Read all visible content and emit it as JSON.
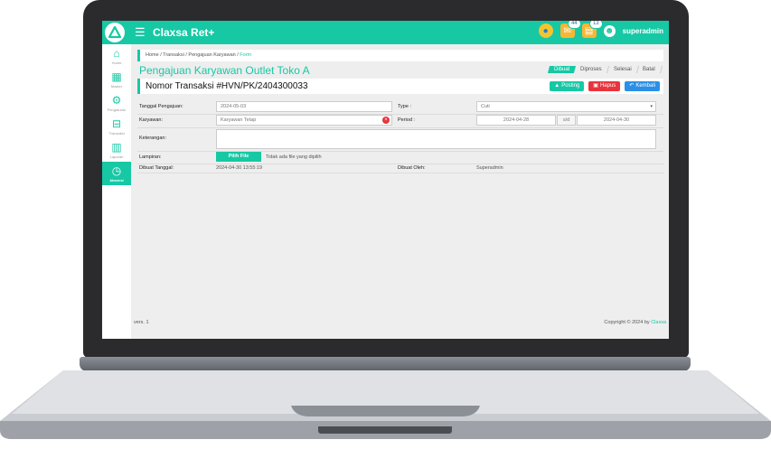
{
  "app": {
    "title": "Claxsa Ret+",
    "user": "superadmin",
    "badges": {
      "mail": "44",
      "notif": "13"
    }
  },
  "sidebar": {
    "items": [
      {
        "label": "Home",
        "icon": "home-icon"
      },
      {
        "label": "Master",
        "icon": "grid-icon"
      },
      {
        "label": "Pengaturan",
        "icon": "gears-icon"
      },
      {
        "label": "Transaksi",
        "icon": "basket-icon"
      },
      {
        "label": "Laporan",
        "icon": "bar-chart-icon"
      },
      {
        "label": "Absensi",
        "icon": "clock-icon"
      }
    ]
  },
  "breadcrumb": {
    "home": "Home",
    "sep": "/",
    "transaksi": "Transaksi",
    "pengajuan": "Pengajuan Karyawan",
    "current": "Form"
  },
  "page": {
    "title": "Pengajuan Karyawan Outlet Toko A",
    "trx": "Nomor Transaksi #HVN/PK/2404300033"
  },
  "status": {
    "steps": [
      "Dibuat",
      "Diproses",
      "Selesai",
      "Batal"
    ]
  },
  "buttons": {
    "posting": "Posting",
    "hapus": "Hapus",
    "kembali": "Kembali"
  },
  "form": {
    "tanggal_label": "Tanggal Pengajuan:",
    "tanggal_value": "2024-05-03",
    "type_label": "Type :",
    "type_value": "Cuti",
    "karyawan_label": "Karyawan:",
    "karyawan_value": "Karyawan Tetap",
    "periode_label": "Period :",
    "periode_from": "2024-04-28",
    "periode_sd": "s/d",
    "periode_to": "2024-04-30",
    "keterangan_label": "Keterangan:",
    "lampiran_label": "Lampiran:",
    "file_button": "Pilih File",
    "file_status": "Tidak ada file yang dipilih",
    "dibuat_tanggal_label": "Dibuat Tanggal:",
    "dibuat_tanggal_value": "2024-04-30 13:55:19",
    "dibuat_oleh_label": "Dibuat Oleh:",
    "dibuat_oleh_value": "Superadmin"
  },
  "footer": {
    "version": "vers. 1",
    "copyright": "Copyright © 2024 by",
    "brand": "Claxsa"
  },
  "colors": {
    "accent": "#17c8a5",
    "danger": "#e8343c",
    "primary": "#2b8fe6"
  }
}
